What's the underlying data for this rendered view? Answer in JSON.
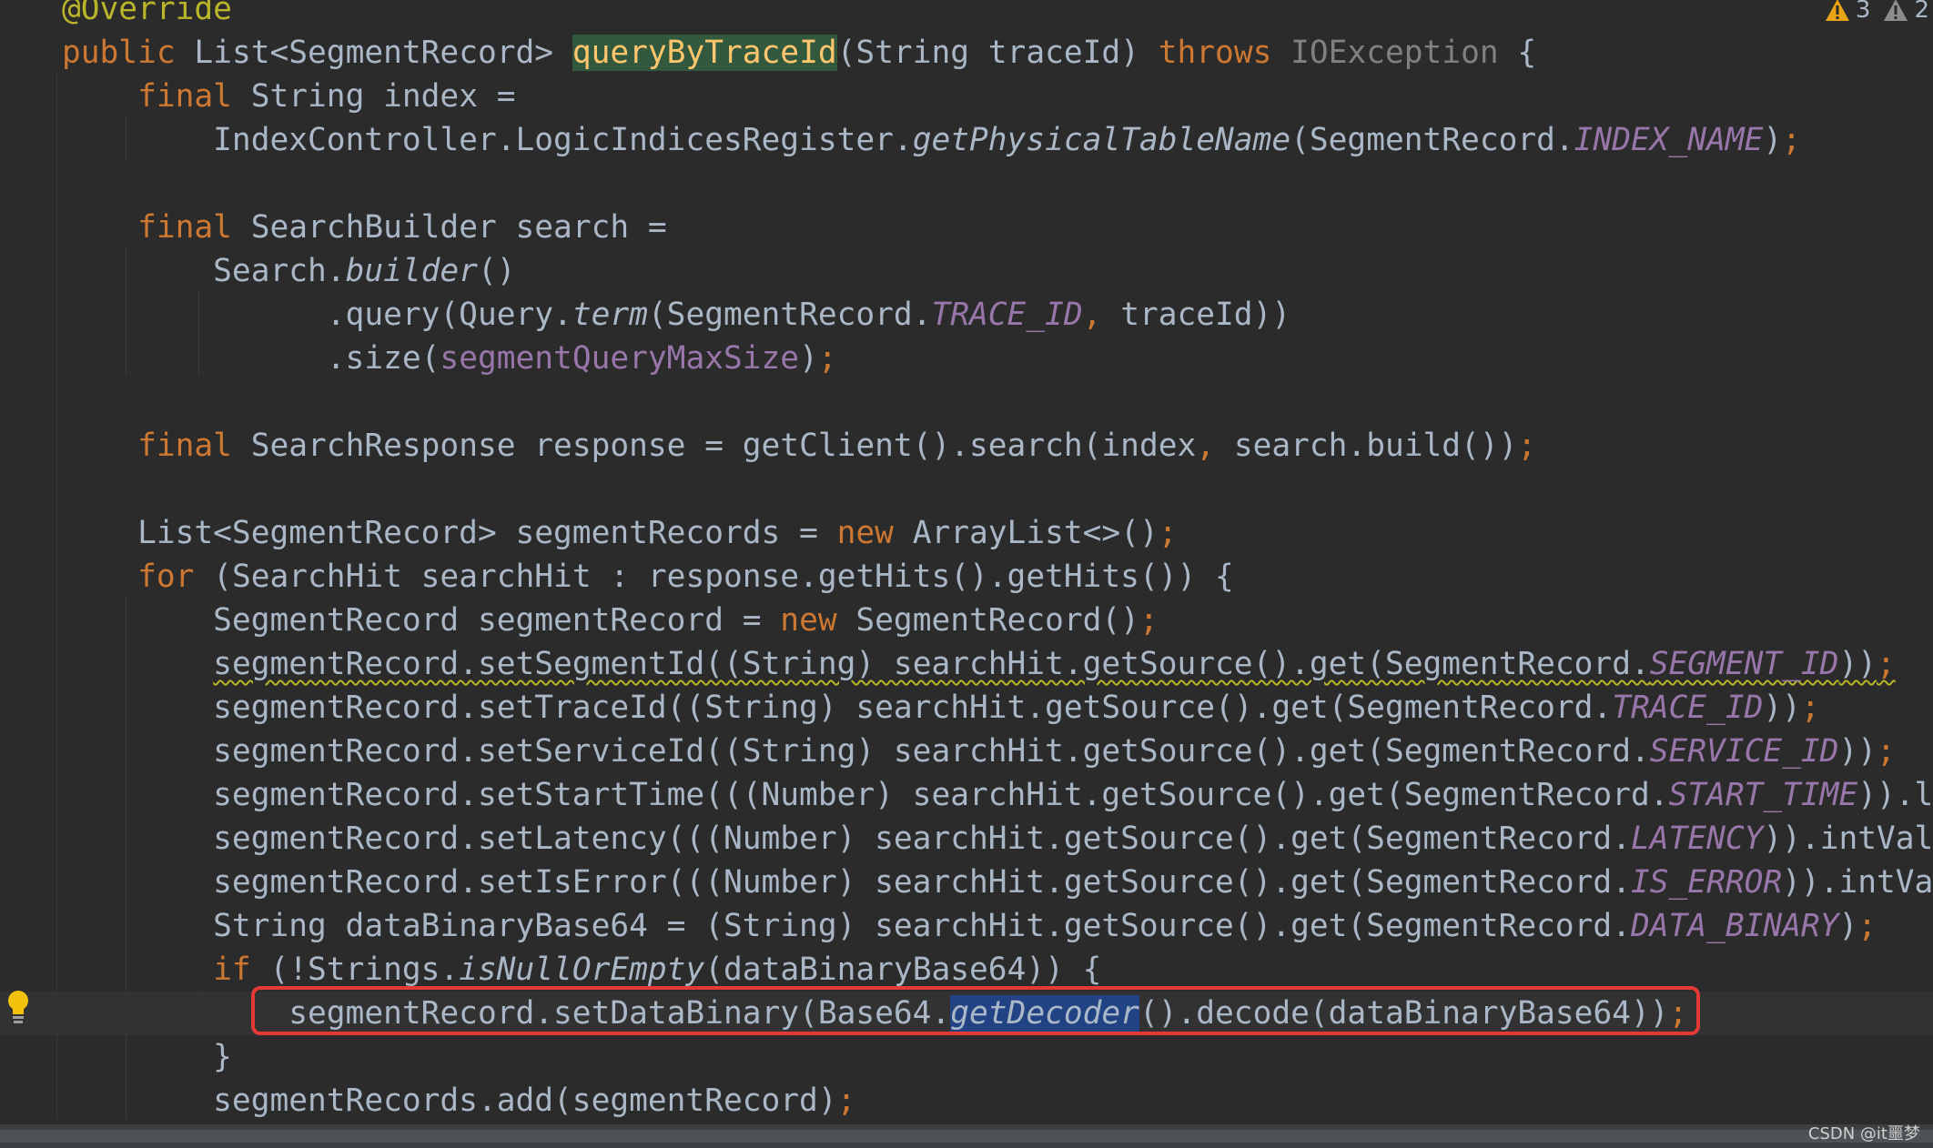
{
  "warnings": {
    "warning_count": "3",
    "weak_warning_count": "2",
    "warning_color": "#e8a317",
    "weak_warning_color": "#8c8c8c"
  },
  "code": {
    "lines": [
      [
        {
          "t": "@Override",
          "c": "ann"
        }
      ],
      [
        {
          "t": "public ",
          "c": "kw"
        },
        {
          "t": "List<SegmentRecord> ",
          "c": ""
        },
        {
          "t": "queryByTraceId",
          "c": "fnhl"
        },
        {
          "t": "(String traceId) ",
          "c": ""
        },
        {
          "t": "throws ",
          "c": "kw"
        },
        {
          "t": "IOException",
          "c": "gray"
        },
        {
          "t": " {",
          "c": ""
        }
      ],
      [
        {
          "t": "    final ",
          "c": "kw"
        },
        {
          "t": "String index =",
          "c": ""
        }
      ],
      [
        {
          "t": "        IndexController.LogicIndicesRegister.",
          "c": ""
        },
        {
          "t": "getPhysicalTableName",
          "c": "italic"
        },
        {
          "t": "(SegmentRecord.",
          "c": ""
        },
        {
          "t": "INDEX_NAME",
          "c": "const"
        },
        {
          "t": ")",
          "c": ""
        },
        {
          "t": ";",
          "c": "kw"
        }
      ],
      [],
      [
        {
          "t": "    final ",
          "c": "kw"
        },
        {
          "t": "SearchBuilder search =",
          "c": ""
        }
      ],
      [
        {
          "t": "        Search.",
          "c": ""
        },
        {
          "t": "builder",
          "c": "italic"
        },
        {
          "t": "()",
          "c": ""
        }
      ],
      [
        {
          "t": "              .query(Query.",
          "c": ""
        },
        {
          "t": "term",
          "c": "italic"
        },
        {
          "t": "(SegmentRecord.",
          "c": ""
        },
        {
          "t": "TRACE_ID",
          "c": "const"
        },
        {
          "t": ", ",
          "c": "kw"
        },
        {
          "t": "traceId))",
          "c": ""
        }
      ],
      [
        {
          "t": "              .size(",
          "c": ""
        },
        {
          "t": "segmentQueryMaxSize",
          "c": "field"
        },
        {
          "t": ")",
          "c": ""
        },
        {
          "t": ";",
          "c": "kw"
        }
      ],
      [],
      [
        {
          "t": "    final ",
          "c": "kw"
        },
        {
          "t": "SearchResponse response = getClient().search(index",
          "c": ""
        },
        {
          "t": ", ",
          "c": "kw"
        },
        {
          "t": "search.build())",
          "c": ""
        },
        {
          "t": ";",
          "c": "kw"
        }
      ],
      [],
      [
        {
          "t": "    List<SegmentRecord> segmentRecords = ",
          "c": ""
        },
        {
          "t": "new ",
          "c": "kw"
        },
        {
          "t": "ArrayList<>()",
          "c": ""
        },
        {
          "t": ";",
          "c": "kw"
        }
      ],
      [
        {
          "t": "    for ",
          "c": "kw"
        },
        {
          "t": "(SearchHit searchHit : response.getHits().getHits()) {",
          "c": ""
        }
      ],
      [
        {
          "t": "        SegmentRecord segmentRecord = ",
          "c": ""
        },
        {
          "t": "new ",
          "c": "kw"
        },
        {
          "t": "SegmentRecord()",
          "c": ""
        },
        {
          "t": ";",
          "c": "kw"
        }
      ],
      [
        {
          "t": "        ",
          "c": ""
        },
        {
          "t": "segmentRecord.setSegmentId((String) searchHit.getSource().get(SegmentRecord.",
          "c": "squiggle"
        },
        {
          "t": "SEGMENT_ID",
          "c": "const squiggle"
        },
        {
          "t": "))",
          "c": "squiggle"
        },
        {
          "t": ";",
          "c": "kw squiggle"
        }
      ],
      [
        {
          "t": "        segmentRecord.setTraceId((String) searchHit.getSource().get(SegmentRecord.",
          "c": ""
        },
        {
          "t": "TRACE_ID",
          "c": "const"
        },
        {
          "t": "))",
          "c": ""
        },
        {
          "t": ";",
          "c": "kw"
        }
      ],
      [
        {
          "t": "        segmentRecord.setServiceId((String) searchHit.getSource().get(SegmentRecord.",
          "c": ""
        },
        {
          "t": "SERVICE_ID",
          "c": "const"
        },
        {
          "t": "))",
          "c": ""
        },
        {
          "t": ";",
          "c": "kw"
        }
      ],
      [
        {
          "t": "        segmentRecord.setStartTime(((Number) searchHit.getSource().get(SegmentRecord.",
          "c": ""
        },
        {
          "t": "START_TIME",
          "c": "const"
        },
        {
          "t": ")).longValue()",
          "c": ""
        }
      ],
      [
        {
          "t": "        segmentRecord.setLatency(((Number) searchHit.getSource().get(SegmentRecord.",
          "c": ""
        },
        {
          "t": "LATENCY",
          "c": "const"
        },
        {
          "t": ")).intValue())",
          "c": ""
        }
      ],
      [
        {
          "t": "        segmentRecord.setIsError(((Number) searchHit.getSource().get(SegmentRecord.",
          "c": ""
        },
        {
          "t": "IS_ERROR",
          "c": "const"
        },
        {
          "t": ")).intValue()",
          "c": ""
        }
      ],
      [
        {
          "t": "        String dataBinaryBase64 = (String) searchHit.getSource().get(SegmentRecord.",
          "c": ""
        },
        {
          "t": "DATA_BINARY",
          "c": "const"
        },
        {
          "t": ")",
          "c": ""
        },
        {
          "t": ";",
          "c": "kw"
        }
      ],
      [
        {
          "t": "        if ",
          "c": "kw"
        },
        {
          "t": "(!Strings.",
          "c": ""
        },
        {
          "t": "isNullOrEmpty",
          "c": "italic"
        },
        {
          "t": "(dataBinaryBase64)) {",
          "c": ""
        }
      ],
      [
        {
          "t": "            segmentRecord.setDataBinary(Base64.",
          "c": ""
        },
        {
          "t": "getDecoder",
          "c": "italic sel"
        },
        {
          "t": "().decode(dataBinaryBase64))",
          "c": ""
        },
        {
          "t": ";",
          "c": "kw"
        }
      ],
      [
        {
          "t": "        }",
          "c": ""
        }
      ],
      [
        {
          "t": "        segmentRecords.add(segmentRecord)",
          "c": ""
        },
        {
          "t": ";",
          "c": "kw"
        }
      ]
    ]
  },
  "watermark": "CSDN @it噩梦"
}
